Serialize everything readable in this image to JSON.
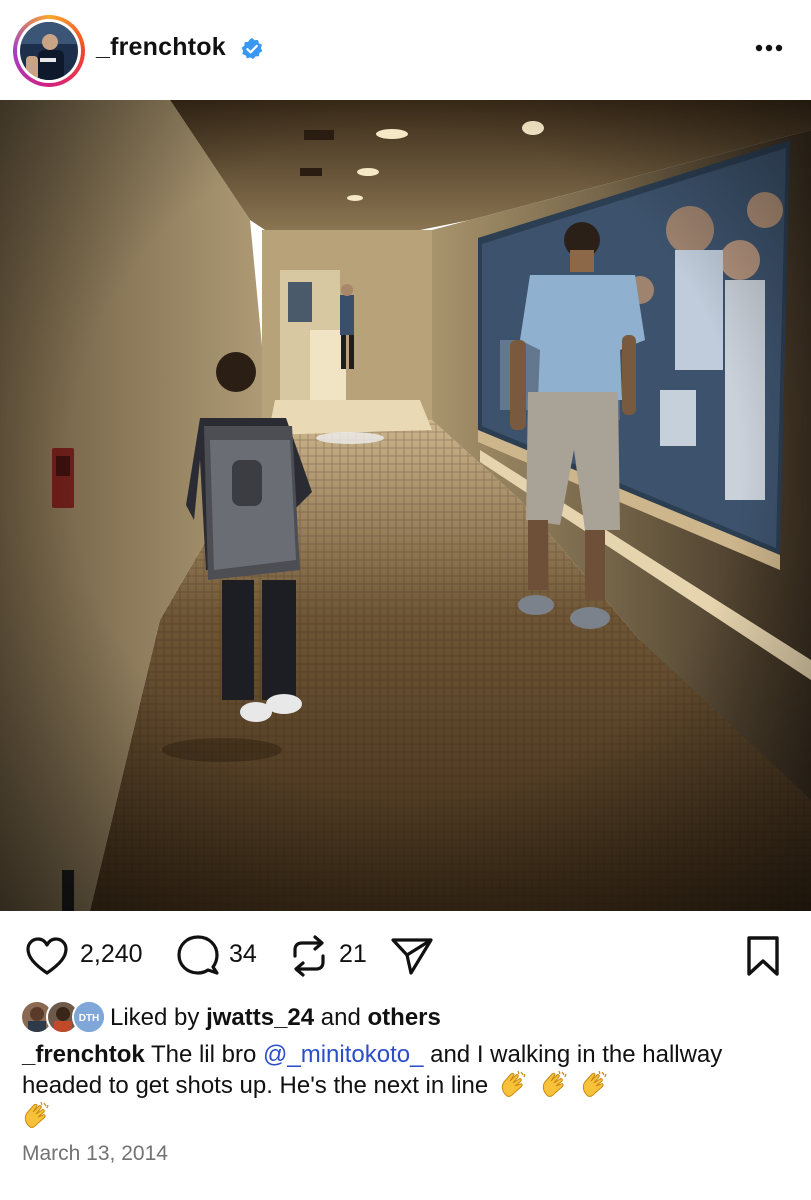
{
  "header": {
    "username": "_frenchtok",
    "verified": true,
    "icons": {
      "avatar": "profile-avatar",
      "verified": "verified-badge-icon",
      "more": "more-options-icon"
    }
  },
  "photo": {
    "subject": "hallway-photo",
    "colors": {
      "carpet": "#5a4428",
      "wall": "#9a8666",
      "light": "#f2e3c0"
    }
  },
  "actions": {
    "like_count": "2,240",
    "comment_count": "34",
    "repost_count": "21",
    "icons": [
      "heart-icon",
      "comment-icon",
      "repost-icon",
      "share-icon",
      "bookmark-icon"
    ]
  },
  "likes": {
    "prefix": "Liked by",
    "user": "jwatts_24",
    "middle": "and",
    "suffix": "others",
    "avatar_badge": "DTH"
  },
  "caption": {
    "username": "_frenchtok",
    "text_before": "The lil bro",
    "mention": "@_minitokoto_",
    "text_after": "and I walking in the hallway headed to get shots up. He's the next in line",
    "emoji": "clapping-hands"
  },
  "date": "March 13, 2014",
  "colors": {
    "text": "#111111",
    "muted": "#737373",
    "mention": "#2b4ec9",
    "verified": "#3897f0"
  }
}
